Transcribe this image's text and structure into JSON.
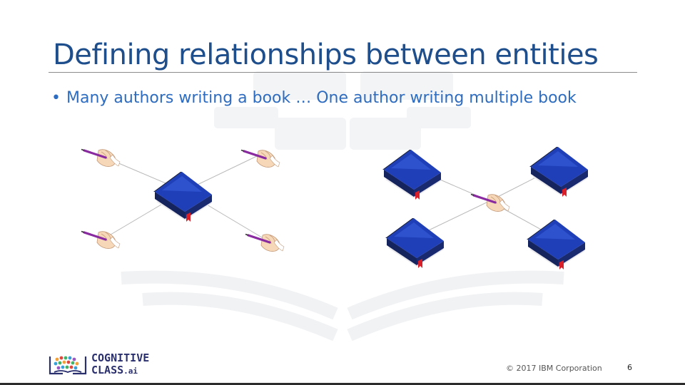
{
  "slide": {
    "title": "Defining relationships between entities",
    "bullet": "Many authors writing a book  …  One author writing multiple book",
    "bullet_marker": "•",
    "footer": {
      "logo_line1": "COGNITIVE",
      "logo_line2": "CLASS",
      "logo_suffix": ".ai",
      "copyright": "© 2017 IBM Corporation",
      "page_number": "6"
    }
  },
  "diagrams": {
    "left": {
      "hub": "book-icon",
      "spokes": [
        "writing-hand-icon",
        "writing-hand-icon",
        "writing-hand-icon",
        "writing-hand-icon"
      ]
    },
    "right": {
      "hub": "writing-hand-icon",
      "spokes": [
        "book-icon",
        "book-icon",
        "book-icon",
        "book-icon"
      ]
    }
  },
  "colors": {
    "title": "#1f4e8c",
    "bullet": "#2e6cc0",
    "book_cover": "#1f3fb8",
    "book_spine": "#16245e",
    "bookmark": "#d8202a",
    "pen": "#8a2aa0"
  }
}
